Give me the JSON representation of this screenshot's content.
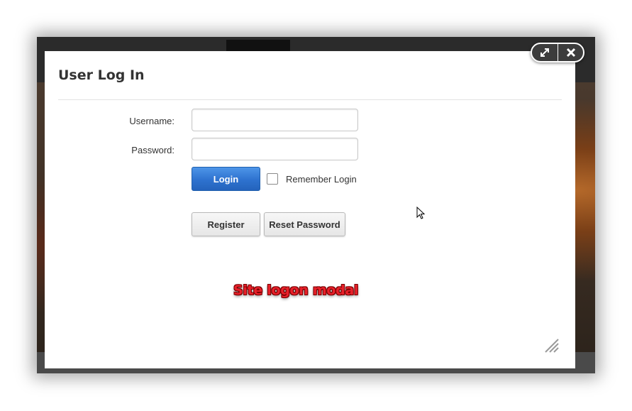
{
  "modal": {
    "title": "User Log In",
    "username_label": "Username:",
    "username_value": "",
    "password_label": "Password:",
    "password_value": "",
    "login_label": "Login",
    "remember_label": "Remember Login",
    "remember_checked": false,
    "register_label": "Register",
    "reset_label": "Reset Password"
  },
  "window_controls": {
    "maximize_icon": "expand-arrows-icon",
    "close_icon": "close-x-icon"
  },
  "annotation": {
    "caption": "Site logon modal"
  },
  "colors": {
    "login_button": "#2e72cf",
    "caption": "#e8202a",
    "backdrop": "#2b2b2b"
  }
}
